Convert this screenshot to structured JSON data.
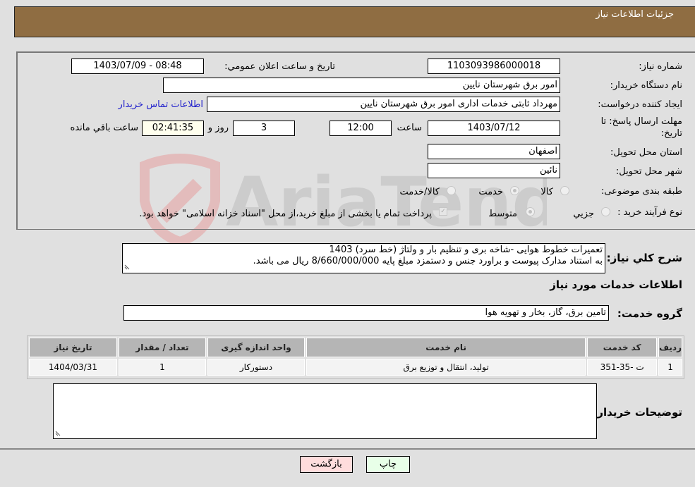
{
  "header": {
    "title": "جزئیات اطلاعات نیاز"
  },
  "form": {
    "need_number": {
      "label": "شماره نیاز:",
      "value": "1103093986000018"
    },
    "announce_datetime": {
      "label": "تاریخ و ساعت اعلان عمومي:",
      "value": "1403/07/09 - 08:48"
    },
    "buyer_org": {
      "label": "نام دستگاه خریدار:",
      "value": "امور برق شهرستان نایین"
    },
    "requester": {
      "label": "ایجاد کننده درخواست:",
      "value": "مهرداد ثابتی خدمات اداری امور برق شهرستان نایین",
      "contact_link": "اطلاعات تماس خریدار"
    },
    "deadline": {
      "label_line1": "مهلت ارسال پاسخ: تا",
      "label_line2": "تاریخ:",
      "date": "1403/07/12",
      "time_label": "ساعت",
      "time": "12:00",
      "days": "3",
      "days_label": "روز و",
      "remaining": "02:41:35",
      "remaining_label": "ساعت باقي مانده"
    },
    "province": {
      "label": "استان محل تحویل:",
      "value": "اصفهان"
    },
    "city": {
      "label": "شهر محل تحویل:",
      "value": "نائین"
    },
    "category": {
      "label": "طبقه بندی موضوعی:",
      "options": [
        "کالا",
        "خدمت",
        "کالا/خدمت"
      ],
      "selected": "خدمت"
    },
    "purchase_type": {
      "label": "نوع فرآیند خرید :",
      "options": [
        "جزيي",
        "متوسط"
      ],
      "selected": "متوسط",
      "treasury_note": "پرداخت تمام یا بخشی از مبلغ خرید،از محل \"اسناد خزانه اسلامی\" خواهد بود.",
      "treasury_checked": true
    }
  },
  "description": {
    "label": "شرح كلي نياز:",
    "line1": "تعمیرات خطوط هوایی -شاخه بری و تنظیم بار و ولتاژ (خط سرد) 1403",
    "line2": "به استناد مدارک پیوست و براورد جنس و دستمزد مبلغ پایه 8/660/000/000 ریال می باشد."
  },
  "services_section": {
    "title": "اطلاعات خدمات مورد نیاز",
    "group_label": "گروه خدمت:",
    "group_value": "تامین برق، گاز، بخار و تهویه هوا"
  },
  "table": {
    "headers": [
      "ردیف",
      "کد خدمت",
      "نام خدمت",
      "واحد اندازه گیری",
      "تعداد / مقدار",
      "تاریخ نیاز"
    ],
    "rows": [
      [
        "1",
        "ت -35-351",
        "تولید، انتقال و توزیع برق",
        "دستورکار",
        "1",
        "1404/03/31"
      ]
    ]
  },
  "buyer_notes": {
    "label": "توضیحات خریدار:",
    "value": ""
  },
  "buttons": {
    "print": "چاپ",
    "back": "بازگشت"
  },
  "watermark": {
    "text": "AriaTender.neT"
  }
}
